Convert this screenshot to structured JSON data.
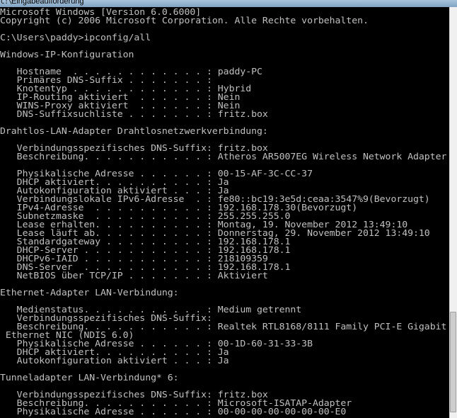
{
  "window": {
    "title": "Eingabeaufforderung",
    "icon": "console-icon"
  },
  "console": {
    "lines": [
      "Microsoft Windows [Version 6.0.6000]",
      "Copyright (c) 2006 Microsoft Corporation. Alle Rechte vorbehalten.",
      "",
      "C:\\Users\\paddy>ipconfig/all",
      "",
      "Windows-IP-Konfiguration",
      "",
      "   Hostname  . . . . . . . . . . . . : paddy-PC",
      "   Primäres DNS-Suffix . . . . . . . :",
      "   Knotentyp . . . . . . . . . . . . : Hybrid",
      "   IP-Routing aktiviert  . . . . . . : Nein",
      "   WINS-Proxy aktiviert  . . . . . . : Nein",
      "   DNS-Suffixsuchliste . . . . . . . : fritz.box",
      "",
      "Drahtlos-LAN-Adapter Drahtlosnetzwerkverbindung:",
      "",
      "   Verbindungsspezifisches DNS-Suffix: fritz.box",
      "   Beschreibung. . . . . . . . . . . : Atheros AR5007EG Wireless Network Adapter",
      "",
      "   Physikalische Adresse . . . . . . : 00-15-AF-3C-CC-37",
      "   DHCP aktiviert. . . . . . . . . . : Ja",
      "   Autokonfiguration aktiviert . . . : Ja",
      "   Verbindungslokale IPv6-Adresse  . : fe80::bc19:3e5d:ceaa:3547%9(Bevorzugt)",
      "   IPv4-Adresse  . . . . . . . . . . : 192.168.178.30(Bevorzugt)",
      "   Subnetzmaske  . . . . . . . . . . : 255.255.255.0",
      "   Lease erhalten. . . . . . . . . . : Montag, 19. November 2012 13:49:10",
      "   Lease läuft ab. . . . . . . . . . : Donnerstag, 29. November 2012 13:49:10",
      "   Standardgateway . . . . . . . . . : 192.168.178.1",
      "   DHCP-Server . . . . . . . . . . . : 192.168.178.1",
      "   DHCPv6-IAID . . . . . . . . . . . : 218109359",
      "   DNS-Server  . . . . . . . . . . . : 192.168.178.1",
      "   NetBIOS über TCP/IP . . . . . . . : Aktiviert",
      "",
      "Ethernet-Adapter LAN-Verbindung:",
      "",
      "   Medienstatus. . . . . . . . . . . : Medium getrennt",
      "   Verbindungsspezifisches DNS-Suffix:",
      "   Beschreibung. . . . . . . . . . . : Realtek RTL8168/8111 Family PCI-E Gigabit",
      " Ethernet NIC (NDIS 6.0)",
      "   Physikalische Adresse . . . . . . : 00-1D-60-31-33-3B",
      "   DHCP aktiviert. . . . . . . . . . : Ja",
      "   Autokonfiguration aktiviert . . . : Ja",
      "",
      "Tunneladapter LAN-Verbindung* 6:",
      "",
      "   Verbindungsspezifisches DNS-Suffix: fritz.box",
      "   Beschreibung. . . . . . . . . . . : Microsoft-ISATAP-Adapter",
      "   Physikalische Adresse . . . . . . : 00-00-00-00-00-00-00-E0"
    ]
  }
}
